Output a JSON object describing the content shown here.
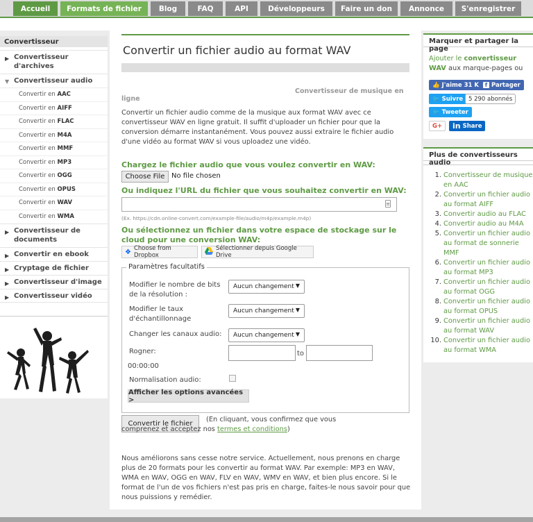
{
  "nav": {
    "tabs": [
      {
        "label": "Accueil",
        "state": "active"
      },
      {
        "label": "Formats de fichier",
        "state": "current"
      },
      {
        "label": "Blog"
      },
      {
        "label": "FAQ"
      },
      {
        "label": "API"
      },
      {
        "label": "Développeurs"
      },
      {
        "label": "Faire un don"
      },
      {
        "label": "Annonce"
      },
      {
        "label": "S'enregistrer"
      }
    ]
  },
  "sidebar": {
    "heading": "Convertisseur",
    "archives": "Convertisseur d'archives",
    "audio": "Convertisseur audio",
    "audio_items": [
      {
        "prefix": "Convertir en ",
        "fmt": "AAC"
      },
      {
        "prefix": "Convertir en ",
        "fmt": "AIFF"
      },
      {
        "prefix": "Convertir en ",
        "fmt": "FLAC"
      },
      {
        "prefix": "Convertir en ",
        "fmt": "M4A"
      },
      {
        "prefix": "Convertir en ",
        "fmt": "MMF"
      },
      {
        "prefix": "Convertir en ",
        "fmt": "MP3"
      },
      {
        "prefix": "Convertir en ",
        "fmt": "OGG"
      },
      {
        "prefix": "Convertir en ",
        "fmt": "OPUS"
      },
      {
        "prefix": "Convertir en ",
        "fmt": "WAV"
      },
      {
        "prefix": "Convertir en ",
        "fmt": "WMA"
      }
    ],
    "documents": "Convertisseur de documents",
    "ebook": "Convertir en ebook",
    "crypt": "Cryptage de fichier",
    "image": "Convertisseur d'image",
    "video": "Convertisseur vidéo"
  },
  "main": {
    "title": "Convertir un fichier audio au format WAV",
    "crumb_right": "Convertisseur de musique en",
    "crumb_left": "ligne",
    "intro": "Convertir un fichier audio comme de la musique aux format WAV avec ce convertisseur WAV en ligne gratuit. Il suffit d'uploader un fichier pour que la conversion démarre instantanément. Vous pouvez aussi extraire le fichier audio d'une vidéo au format WAV si vous uploadez une vidéo.",
    "upload_label": "Chargez le fichier audio que vous voulez convertir en WAV:",
    "choose_file": "Choose File",
    "no_file": "No file chosen",
    "url_label": "Ou indiquez l'URL du fichier que vous souhaitez convertir en WAV:",
    "url_example": "(Ex. https://cdn.online-convert.com/example-file/audio/m4p/example.m4p)",
    "cloud_label": "Ou sélectionnez un fichier dans votre espace de stockage sur le cloud pour une conversion WAV:",
    "dropbox": "Choose from Dropbox",
    "gdrive": "Sélectionner depuis Google Drive",
    "optional_params": "Paramètres facultatifs",
    "bits_label": "Modifier le nombre de bits de la résolution :",
    "rate_label": "Modifier le taux d'échantillonnage",
    "channels_label": "Changer les canaux audio:",
    "select_value": "Aucun changement",
    "trim_label": "Rogner:",
    "trim_time": "00:00:00",
    "to": "to",
    "normalize": "Normalisation audio:",
    "advanced": "Afficher les options avancées >",
    "convert_btn": "Convertir le fichier",
    "terms_before": "(En cliquant, vous confirmez que vous comprenez et acceptez nos ",
    "terms_link": "termes et conditions",
    "terms_after": ")",
    "outro": "Nous améliorons sans cesse notre service. Actuellement, nous prenons en charge plus de 20 formats pour les convertir au format WAV. Par exemple: MP3 en WAV, WMA en WAV, OGG en WAV, FLV en WAV, WMV en WAV, et bien plus encore. Si le format de l'un de vos fichiers n'est pas pris en charge, faites-le nous savoir pour que nous puissions y remédier."
  },
  "share": {
    "title": "Marquer et partager la page",
    "text_before": "Ajouter le ",
    "text_link": "convertisseur WAV",
    "text_after": " aux marque-pages ou",
    "like": "J'aime 31 K",
    "fb_share": "Partager",
    "follow": "Suivre",
    "followers": "5 290 abonnés",
    "tweet": "Tweeter",
    "gplus": "G+",
    "li_share": "Share"
  },
  "more": {
    "title": "Plus de convertisseurs audio",
    "items": [
      "Convertisseur de musique en AAC",
      "Convertir un fichier audio au format AIFF",
      "Convertir audio au FLAC",
      "Convertir audio au M4A",
      "Convertir un fichier audio au format de sonnerie MMF",
      "Convertir un fichier audio au format MP3",
      "Convertir un fichier audio au format OGG",
      "Convertir un fichier audio au format OPUS",
      "Convertir un fichier audio au format WAV",
      "Convertir un fichier audio au format WMA"
    ]
  },
  "colors": {
    "accent_green": "#5e9a44",
    "nav_grey": "#8a8a8a",
    "facebook": "#4267b2",
    "twitter": "#1da1f2",
    "linkedin": "#0a66c2"
  }
}
